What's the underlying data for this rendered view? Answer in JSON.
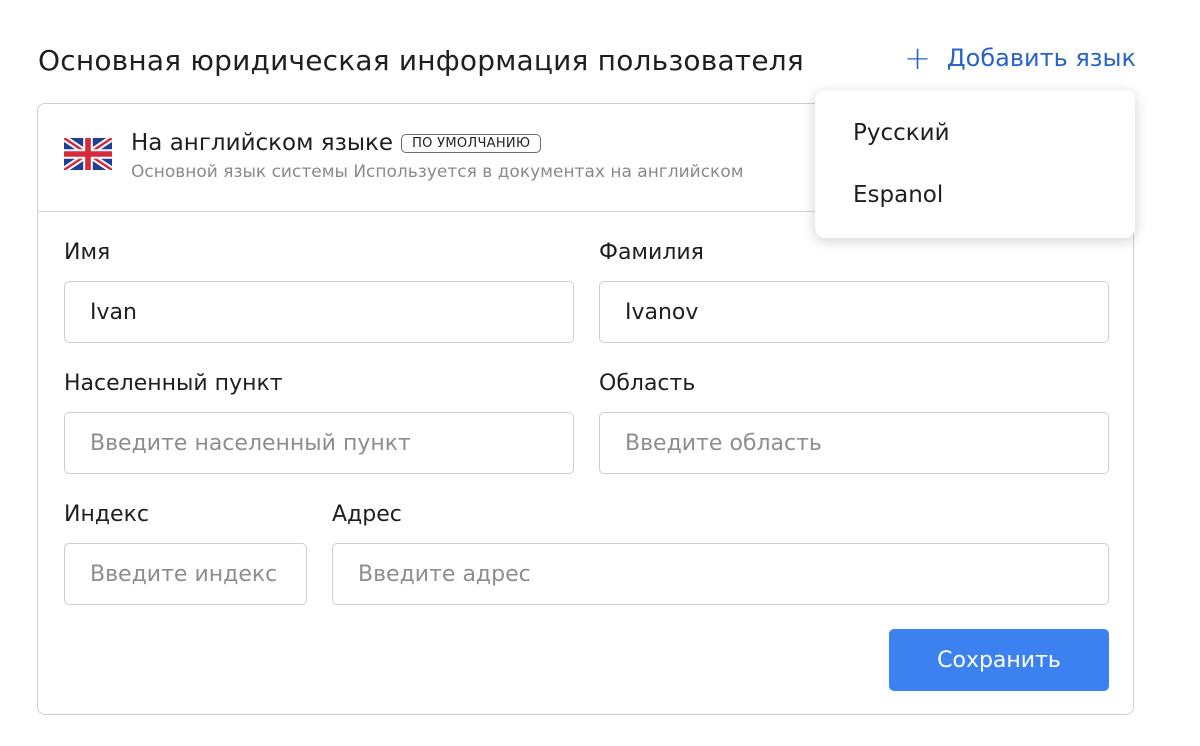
{
  "header": {
    "title": "Основная юридическая информация пользователя",
    "add_language_label": "Добавить язык"
  },
  "language_card": {
    "flag": "uk-flag-icon",
    "title": "На английском языке",
    "badge": "ПО УМОЛЧАНИЮ",
    "description": "Основной язык системы Используется в документах на английском"
  },
  "form": {
    "first_name": {
      "label": "Имя",
      "value": "Ivan"
    },
    "last_name": {
      "label": "Фамилия",
      "value": "Ivanov"
    },
    "city": {
      "label": "Населенный пункт",
      "placeholder": "Введите населенный пункт"
    },
    "region": {
      "label": "Область",
      "placeholder": "Введите область"
    },
    "postal_code": {
      "label": "Индекс",
      "placeholder": "Введите индекс"
    },
    "address": {
      "label": "Адрес",
      "placeholder": "Введите адрес"
    },
    "save_label": "Сохранить"
  },
  "language_dropdown": {
    "items": [
      "Русский",
      "Espanol"
    ]
  },
  "colors": {
    "accent": "#2a63c7",
    "button": "#3b82f0",
    "border": "#cfcfcf"
  }
}
